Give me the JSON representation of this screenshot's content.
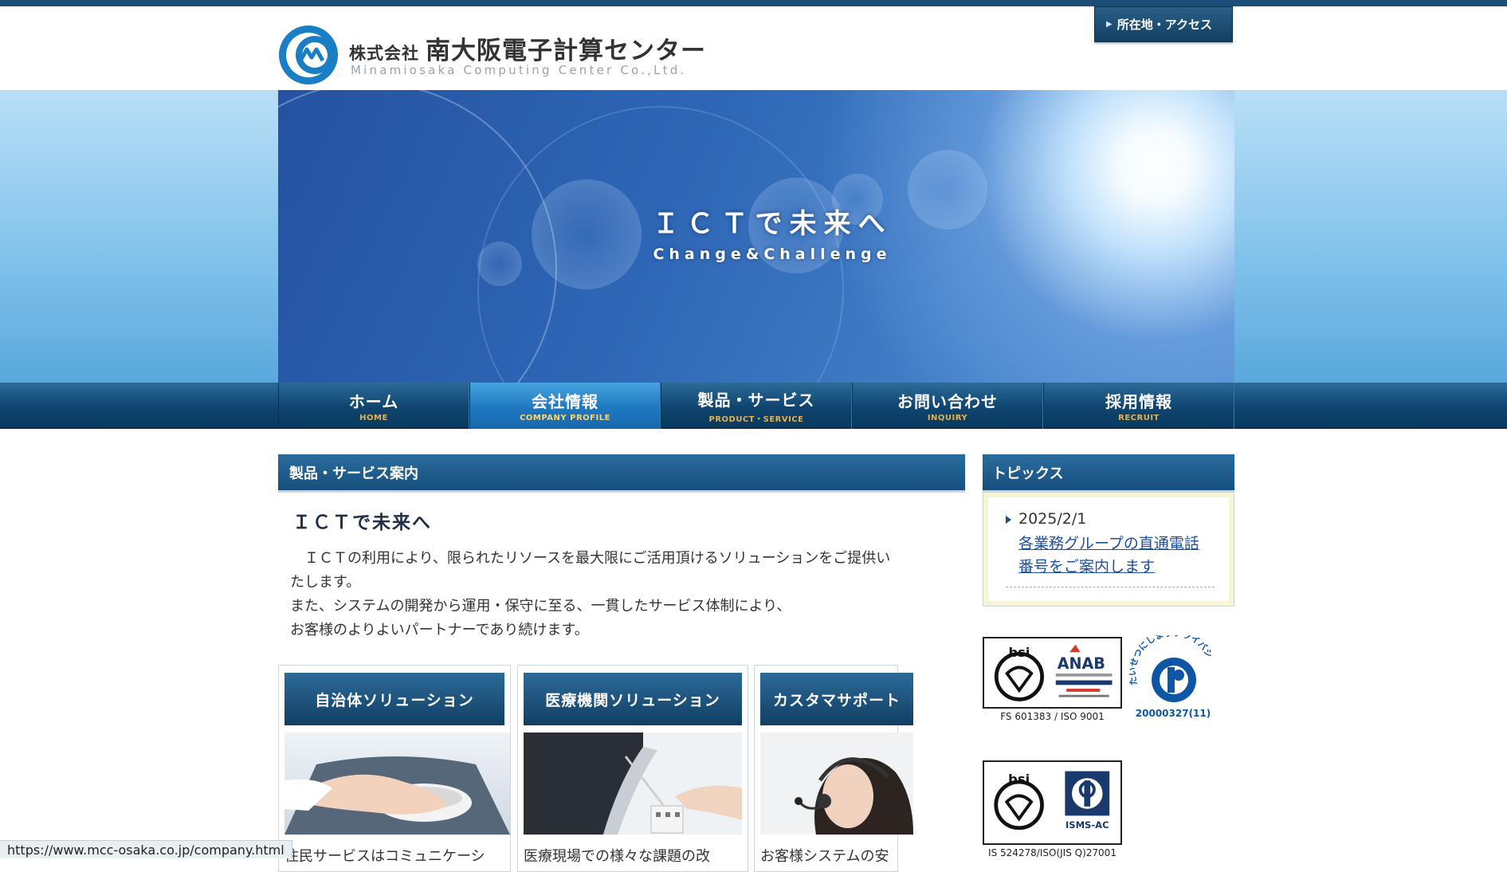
{
  "header": {
    "company_prefix": "株式会社",
    "company_name": "南大阪電子計算センター",
    "company_name_en": "Minamiosaka Computing Center Co.,Ltd.",
    "access_button": "所在地・アクセス"
  },
  "hero": {
    "title": "ＩＣＴで未来へ",
    "subtitle": "Change&Challenge"
  },
  "nav": {
    "items": [
      {
        "jp": "ホーム",
        "en": "HOME"
      },
      {
        "jp": "会社情報",
        "en": "COMPANY PROFILE"
      },
      {
        "jp": "製品・サービス",
        "en": "PRODUCT・SERVICE"
      },
      {
        "jp": "お問い合わせ",
        "en": "INQUIRY"
      },
      {
        "jp": "採用情報",
        "en": "RECRUIT"
      }
    ],
    "active_index": 1
  },
  "main": {
    "section_title": "製品・サービス案内",
    "lead_title": "ＩＣＴで未来へ",
    "lead_lines": [
      "　ＩＣＴの利用により、限られたリソースを最大限にご活用頂けるソリューションをご提供い",
      "たします。",
      "また、システムの開発から運用・保守に至る、一貫したサービス体制により、",
      "お客様のよりよいパートナーであり続けます。"
    ],
    "cards": [
      {
        "title": "自治体ソリューション",
        "text": "住民サービスはコミュニケーシ"
      },
      {
        "title": "医療機関ソリューション",
        "text": "医療現場での様々な課題の改"
      },
      {
        "title": "カスタマサポート",
        "text": "お客様システムの安"
      }
    ]
  },
  "side": {
    "topics_title": "トピックス",
    "topic_date": "2025/2/1",
    "topic_link_line1": "各業務グループの直通電話",
    "topic_link_line2": "番号をご案内します",
    "cert1_caption": "FS 601383 / ISO 9001",
    "cert1_logo": "bsi",
    "cert1_anab": "ANAB",
    "privacy_number": "20000327(11)",
    "privacy_arc": "たいせつにしますプライバシー",
    "cert2_caption": "IS 524278/ISO(JIS Q)27001",
    "cert2_logo": "bsi",
    "cert2_isms": "ISMS-AC"
  },
  "statusbar": {
    "url": "https://www.mcc-osaka.co.jp/company.html"
  },
  "colors": {
    "nav_dark": "#0f4570",
    "nav_active": "#1f78c0",
    "accent_gold": "#e4b24f",
    "link": "#1d4fa0"
  }
}
